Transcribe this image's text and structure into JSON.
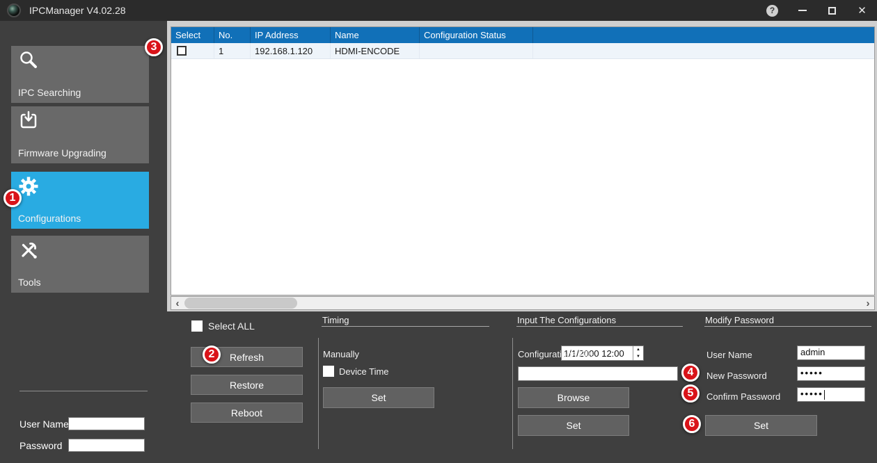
{
  "window": {
    "title": "IPCManager V4.02.28"
  },
  "icons": {
    "help": "?",
    "close": "✕",
    "scroll_left": "‹",
    "scroll_right": "›",
    "spin_up": "▲",
    "spin_down": "▼"
  },
  "sidebar": {
    "items": [
      {
        "label": "IPC Searching",
        "icon": "search",
        "active": false
      },
      {
        "label": "Firmware Upgrading",
        "icon": "firmware-upgrade",
        "active": false
      },
      {
        "label": "Configurations",
        "icon": "gear",
        "active": true
      },
      {
        "label": "Tools",
        "icon": "tools",
        "active": false
      }
    ],
    "login": {
      "user_label": "User Name",
      "user_value": "",
      "password_label": "Password",
      "password_value": ""
    }
  },
  "device_table": {
    "columns": [
      "Select",
      "No.",
      "IP Address",
      "Name",
      "Configuration Status"
    ],
    "rows": [
      {
        "selected": false,
        "no": "1",
        "ip_address": "192.168.1.120",
        "name": "HDMI-ENCODE",
        "configuration_status": ""
      }
    ]
  },
  "actions": {
    "select_all_label": "Select ALL",
    "refresh_label": "Refresh",
    "restore_label": "Restore",
    "reboot_label": "Reboot"
  },
  "timing": {
    "header": "Timing",
    "manually_label": "Manually",
    "datetime_value": "1/1/2000 12:00",
    "device_time_label": "Device Time",
    "set_label": "Set"
  },
  "input_configurations": {
    "header": "Input The Configurations",
    "file_label": "Configurations File",
    "file_value": "",
    "browse_label": "Browse",
    "set_label": "Set"
  },
  "modify_password": {
    "header": "Modify Password",
    "user_name_label": "User Name",
    "user_name_value": "admin",
    "new_password_label": "New Password",
    "new_password_value": "•••••",
    "confirm_password_label": "Confirm Password",
    "confirm_password_value": "•••••",
    "set_label": "Set"
  },
  "annotations": [
    "1",
    "2",
    "3",
    "4",
    "5",
    "6"
  ],
  "colors": {
    "accent_blue": "#29abe2",
    "table_header_blue": "#1170b8",
    "annotation_red": "#d91319",
    "panel_gray": "#3f3f3f",
    "button_gray": "#616161"
  }
}
